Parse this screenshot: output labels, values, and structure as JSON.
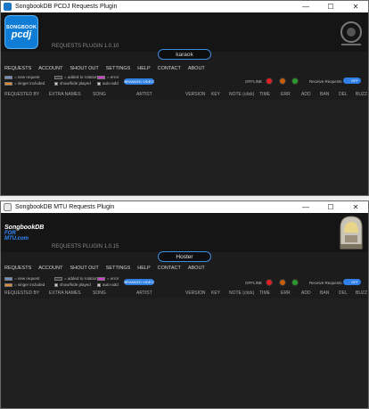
{
  "windows": [
    {
      "title": "SongbookDB PCDJ Requests Plugin",
      "logo_top": "SONGBOOK",
      "logo_bottom": "pcdj",
      "plugin_version": "REQUESTS PLUGIN 1.0.10",
      "host": "karaok",
      "host_color": "#3d8be0"
    },
    {
      "title": "SongbookDB MTU Requests Plugin",
      "logo_top": "SongbookDB",
      "logo_bottom": "FOR MTU.com",
      "plugin_version": "REQUESTS PLUGIN 1.0.15",
      "host": "Hoster",
      "host_color": "#3d8be0"
    }
  ],
  "window_controls": {
    "minimize": "—",
    "maximize": "☐",
    "close": "✕"
  },
  "menu": [
    "REQUESTS",
    "ACCOUNT",
    "SHOUT OUT",
    "SETTINGS",
    "HELP",
    "CONTACT",
    "ABOUT"
  ],
  "legend": {
    "new_request": "= new request",
    "singer_included": "= singer included",
    "added_to_rotation": "= added to rotation",
    "show_hide_played": "show/hide played",
    "error": "= error",
    "auto_add": "auto-add"
  },
  "legend_colors": {
    "new_request": "#6f8fbf",
    "singer_included": "#e38a2f",
    "added_to_rotation": "#3a3a3a",
    "error": "#d13ad1"
  },
  "pill_label": "BRANDED VIDEO",
  "status": {
    "offline_label": "OFFLINE",
    "lights": [
      "#e02020",
      "#c06010",
      "#2a9a2a"
    ],
    "receive_requests_label": "Receive Requests",
    "toggle_label": "OFF"
  },
  "columns": [
    "REQUESTED BY",
    "EXTRA NAMES",
    "SONG",
    "ARTIST",
    "VERSION",
    "KEY",
    "NOTE (click)",
    "TIME",
    "ERR",
    "ADD",
    "BAN",
    "DEL",
    "BUZZ"
  ]
}
